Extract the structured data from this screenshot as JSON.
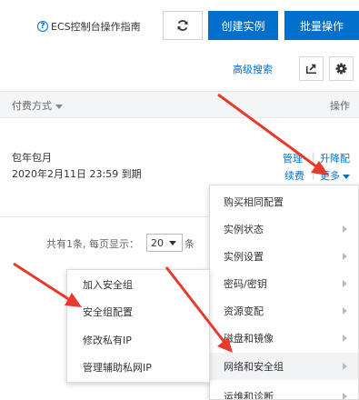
{
  "toolbar": {
    "help_icon": "?",
    "help_text": "ECS控制台操作指南",
    "refresh_icon": "refresh-icon",
    "create_label": "创建实例",
    "batch_label": "批量操作",
    "advanced_search": "高级搜索",
    "export_icon": "export-icon",
    "settings_icon": "gear-icon",
    "accent_color": "#0070cc"
  },
  "table": {
    "header_billing": "付费方式",
    "header_ops": "操作",
    "row": {
      "billing_type": "包年包月",
      "expire": "2020年2月11日 23:59 到期",
      "op_manage": "管理",
      "op_separator": "|",
      "op_upgrade": "升降配",
      "op_renew": "续费",
      "op_more": "更多"
    }
  },
  "pagination": {
    "summary": "共有1条, 每页显示：",
    "page_size": "20",
    "unit": "条"
  },
  "more_menu": {
    "items": [
      {
        "label": "购买相同配置",
        "has_submenu": false
      },
      {
        "label": "实例状态",
        "has_submenu": true
      },
      {
        "label": "实例设置",
        "has_submenu": true
      },
      {
        "label": "密码/密钥",
        "has_submenu": true
      },
      {
        "label": "资源变配",
        "has_submenu": true
      },
      {
        "label": "磁盘和镜像",
        "has_submenu": true
      },
      {
        "label": "网络和安全组",
        "has_submenu": true,
        "active": true
      },
      {
        "label": "运维和诊断",
        "has_submenu": true
      }
    ]
  },
  "network_submenu": {
    "items": [
      {
        "label": "加入安全组"
      },
      {
        "label": "安全组配置"
      },
      {
        "label": "修改私有IP"
      },
      {
        "label": "管理辅助私网IP"
      }
    ]
  },
  "annotation_color": "#e8392b"
}
